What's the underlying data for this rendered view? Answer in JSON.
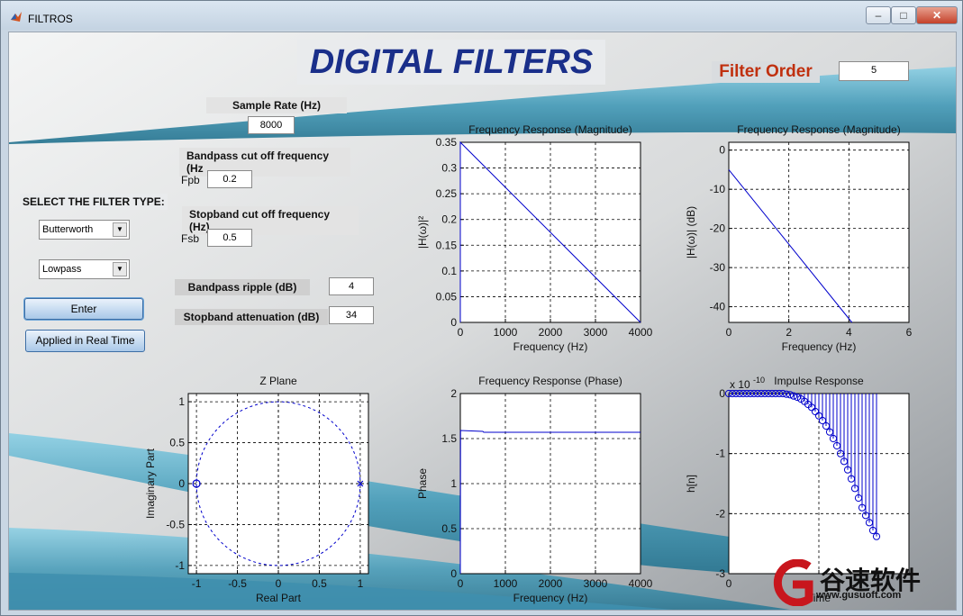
{
  "window": {
    "title": "FILTROS",
    "controls": [
      "–",
      "□",
      "✕"
    ]
  },
  "header": {
    "title": "DIGITAL FILTERS",
    "filter_order_label": "Filter Order",
    "filter_order_value": "5"
  },
  "inputs": {
    "sample_rate_label": "Sample Rate (Hz)",
    "sample_rate_value": "8000",
    "bandpass_cutoff_label": "Bandpass cut off frequency (Hz",
    "fpb_label": "Fpb",
    "fpb_value": "0.2",
    "stopband_cutoff_label": "Stopband cut off frequency (Hz)",
    "fsb_label": "Fsb",
    "fsb_value": "0.5",
    "bandpass_ripple_label": "Bandpass ripple (dB)",
    "bandpass_ripple_value": "4",
    "stopband_atten_label": "Stopband attenuation (dB)",
    "stopband_atten_value": "34"
  },
  "filter_type": {
    "label": "SELECT THE FILTER TYPE:",
    "design_selected": "Butterworth",
    "response_selected": "Lowpass"
  },
  "buttons": {
    "enter": "Enter",
    "realtime": "Applied in Real Time"
  },
  "colors": {
    "title_blue": "#1a2f8a",
    "filter_order_red": "#c0300f",
    "plot_line": "#0000cc",
    "wave_cyan": "#5aa9c4"
  },
  "chart_data": [
    {
      "type": "line",
      "title": "Frequency Response (Magnitude)",
      "xlabel": "Frequency (Hz)",
      "ylabel": "|H(ω)|²",
      "xlim": [
        0,
        4000
      ],
      "ylim": [
        0,
        0.35
      ],
      "xticks": [
        0,
        1000,
        2000,
        3000,
        4000
      ],
      "yticks": [
        0,
        0.05,
        0.1,
        0.15,
        0.2,
        0.25,
        0.3,
        0.35
      ],
      "grid": true,
      "series": [
        {
          "x": [
            0,
            0,
            4000
          ],
          "y": [
            0,
            0.35,
            0
          ]
        }
      ]
    },
    {
      "type": "line",
      "title": "Frequency Response (Magnitude)",
      "xlabel": "Frequency (Hz)",
      "ylabel": "|H(ω)| (dB)",
      "xlim": [
        0,
        6
      ],
      "ylim": [
        -44,
        2
      ],
      "xticks": [
        0,
        2,
        4,
        6
      ],
      "yticks": [
        -40,
        -30,
        -20,
        -10,
        0
      ],
      "grid": true,
      "series": [
        {
          "x": [
            0,
            4.1
          ],
          "y": [
            -5,
            -44
          ]
        }
      ]
    },
    {
      "type": "scatter",
      "title": "Z Plane",
      "xlabel": "Real Part",
      "ylabel": "Imaginary Part",
      "xlim": [
        -1.1,
        1.1
      ],
      "ylim": [
        -1.1,
        1.1
      ],
      "xticks": [
        -1,
        -0.5,
        0,
        0.5,
        1
      ],
      "yticks": [
        -1,
        -0.5,
        0,
        0.5,
        1
      ],
      "grid": true,
      "unit_circle": true,
      "zeros": [
        [
          -1,
          0
        ]
      ],
      "poles": [
        [
          1,
          0
        ]
      ]
    },
    {
      "type": "line",
      "title": "Frequency Response (Phase)",
      "xlabel": "Frequency (Hz)",
      "ylabel": "Phase",
      "xlim": [
        0,
        4000
      ],
      "ylim": [
        0,
        2
      ],
      "xticks": [
        0,
        1000,
        2000,
        3000,
        4000
      ],
      "yticks": [
        0,
        0.5,
        1,
        1.5,
        2
      ],
      "grid": true,
      "series": [
        {
          "x": [
            0,
            5,
            500,
            520,
            4000
          ],
          "y": [
            0,
            1.59,
            1.58,
            1.57,
            1.57
          ]
        }
      ]
    },
    {
      "type": "stem",
      "title": "Impulse Response",
      "xlabel": "Time",
      "ylabel": "h[n]",
      "exponent_label": "x 10",
      "exponent": "-10",
      "xlim": [
        0,
        100
      ],
      "ylim": [
        -3,
        0
      ],
      "xticks": [
        0,
        50,
        100
      ],
      "yticks": [
        -3,
        -2,
        -1,
        0
      ],
      "grid": true,
      "n": [
        0,
        2,
        4,
        6,
        8,
        10,
        12,
        14,
        16,
        18,
        20,
        22,
        24,
        26,
        28,
        30,
        32,
        34,
        36,
        38,
        40,
        42,
        44,
        46,
        48,
        50,
        52,
        54,
        56,
        58,
        60,
        62,
        64,
        66,
        68,
        70,
        72,
        74,
        76,
        78,
        80,
        82
      ],
      "values": [
        0,
        0,
        0,
        0,
        0,
        0,
        0,
        0,
        0,
        0,
        0,
        0,
        0,
        0,
        0,
        0,
        -0.01,
        -0.02,
        -0.04,
        -0.06,
        -0.09,
        -0.13,
        -0.18,
        -0.23,
        -0.3,
        -0.37,
        -0.45,
        -0.54,
        -0.64,
        -0.75,
        -0.87,
        -1.0,
        -1.13,
        -1.27,
        -1.42,
        -1.58,
        -1.74,
        -1.9,
        -2.03,
        -2.15,
        -2.28,
        -2.38
      ]
    }
  ],
  "watermark": {
    "brand_cn": "谷速软件",
    "url": "www.gusuoft.com"
  }
}
